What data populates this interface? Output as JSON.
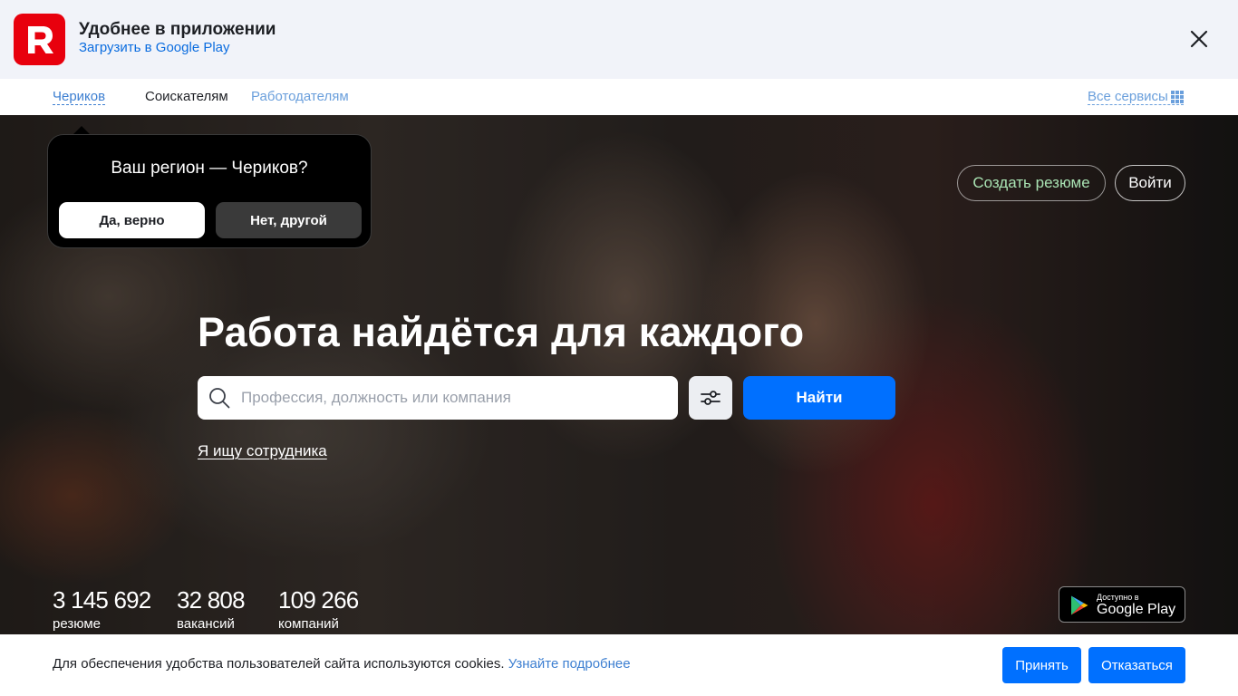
{
  "app_banner": {
    "logo_letter": "R",
    "title": "Удобнее в приложении",
    "link": "Загрузить в Google Play",
    "close_icon": "close-icon"
  },
  "nav": {
    "region": "Чериков",
    "seekers": "Соискателям",
    "employers": "Работодателям",
    "services": "Все сервисы",
    "services_icon": "grid-icon"
  },
  "region_popup": {
    "question": "Ваш регион — Чериков?",
    "yes": "Да, верно",
    "no": "Нет, другой"
  },
  "header_actions": {
    "create_resume": "Создать резюме",
    "login": "Войти"
  },
  "hero": {
    "title": "Работа найдётся для каждого",
    "search_placeholder": "Профессия, должность или компания",
    "search_value": "",
    "search_icon": "search-icon",
    "filter_icon": "filter-sliders-icon",
    "find": "Найти",
    "employer_link": "Я ищу сотрудника"
  },
  "stats": [
    {
      "value": "3 145 692",
      "label": "резюме"
    },
    {
      "value": "32 808",
      "label": "вакансий"
    },
    {
      "value": "109 266",
      "label": "компаний"
    }
  ],
  "gplay": {
    "small": "Доступно в",
    "big": "Google Play",
    "icon": "google-play-icon"
  },
  "cookie": {
    "text": "Для обеспечения удобства пользователей сайта используются cookies.",
    "more": "Узнайте подробнее",
    "accept": "Принять",
    "decline": "Отказаться"
  },
  "colors": {
    "brand_red": "#e8000d",
    "primary_blue": "#0070ff",
    "link_blue": "#3d7fd1",
    "create_resume_green": "#a9e3b3"
  }
}
